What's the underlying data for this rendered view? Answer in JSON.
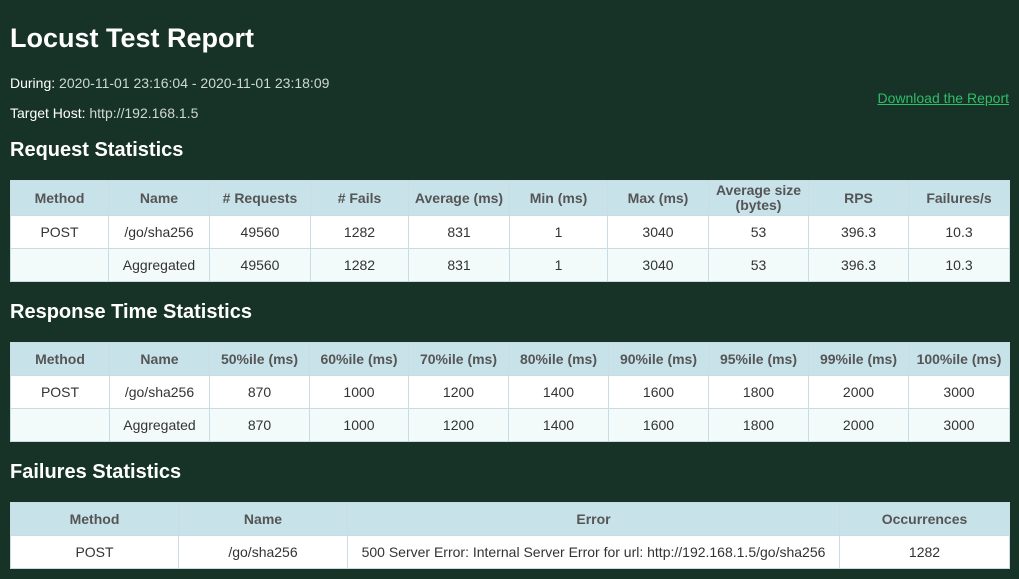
{
  "report": {
    "title": "Locust Test Report",
    "during_label": "During:",
    "during_value": "2020-11-01 23:16:04 - 2020-11-01 23:18:09",
    "host_label": "Target Host:",
    "host_value": "http://192.168.1.5",
    "download_label": "Download the Report"
  },
  "request_stats": {
    "heading": "Request Statistics",
    "headers": [
      "Method",
      "Name",
      "# Requests",
      "# Fails",
      "Average (ms)",
      "Min (ms)",
      "Max (ms)",
      "Average size (bytes)",
      "RPS",
      "Failures/s"
    ],
    "rows": [
      [
        "POST",
        "/go/sha256",
        "49560",
        "1282",
        "831",
        "1",
        "3040",
        "53",
        "396.3",
        "10.3"
      ],
      [
        "",
        "Aggregated",
        "49560",
        "1282",
        "831",
        "1",
        "3040",
        "53",
        "396.3",
        "10.3"
      ]
    ]
  },
  "response_stats": {
    "heading": "Response Time Statistics",
    "headers": [
      "Method",
      "Name",
      "50%ile (ms)",
      "60%ile (ms)",
      "70%ile (ms)",
      "80%ile (ms)",
      "90%ile (ms)",
      "95%ile (ms)",
      "99%ile (ms)",
      "100%ile (ms)"
    ],
    "rows": [
      [
        "POST",
        "/go/sha256",
        "870",
        "1000",
        "1200",
        "1400",
        "1600",
        "1800",
        "2000",
        "3000"
      ],
      [
        "",
        "Aggregated",
        "870",
        "1000",
        "1200",
        "1400",
        "1600",
        "1800",
        "2000",
        "3000"
      ]
    ]
  },
  "failure_stats": {
    "heading": "Failures Statistics",
    "headers": [
      "Method",
      "Name",
      "Error",
      "Occurrences"
    ],
    "rows": [
      [
        "POST",
        "/go/sha256",
        "500 Server Error: Internal Server Error for url: http://192.168.1.5/go/sha256",
        "1282"
      ]
    ]
  }
}
